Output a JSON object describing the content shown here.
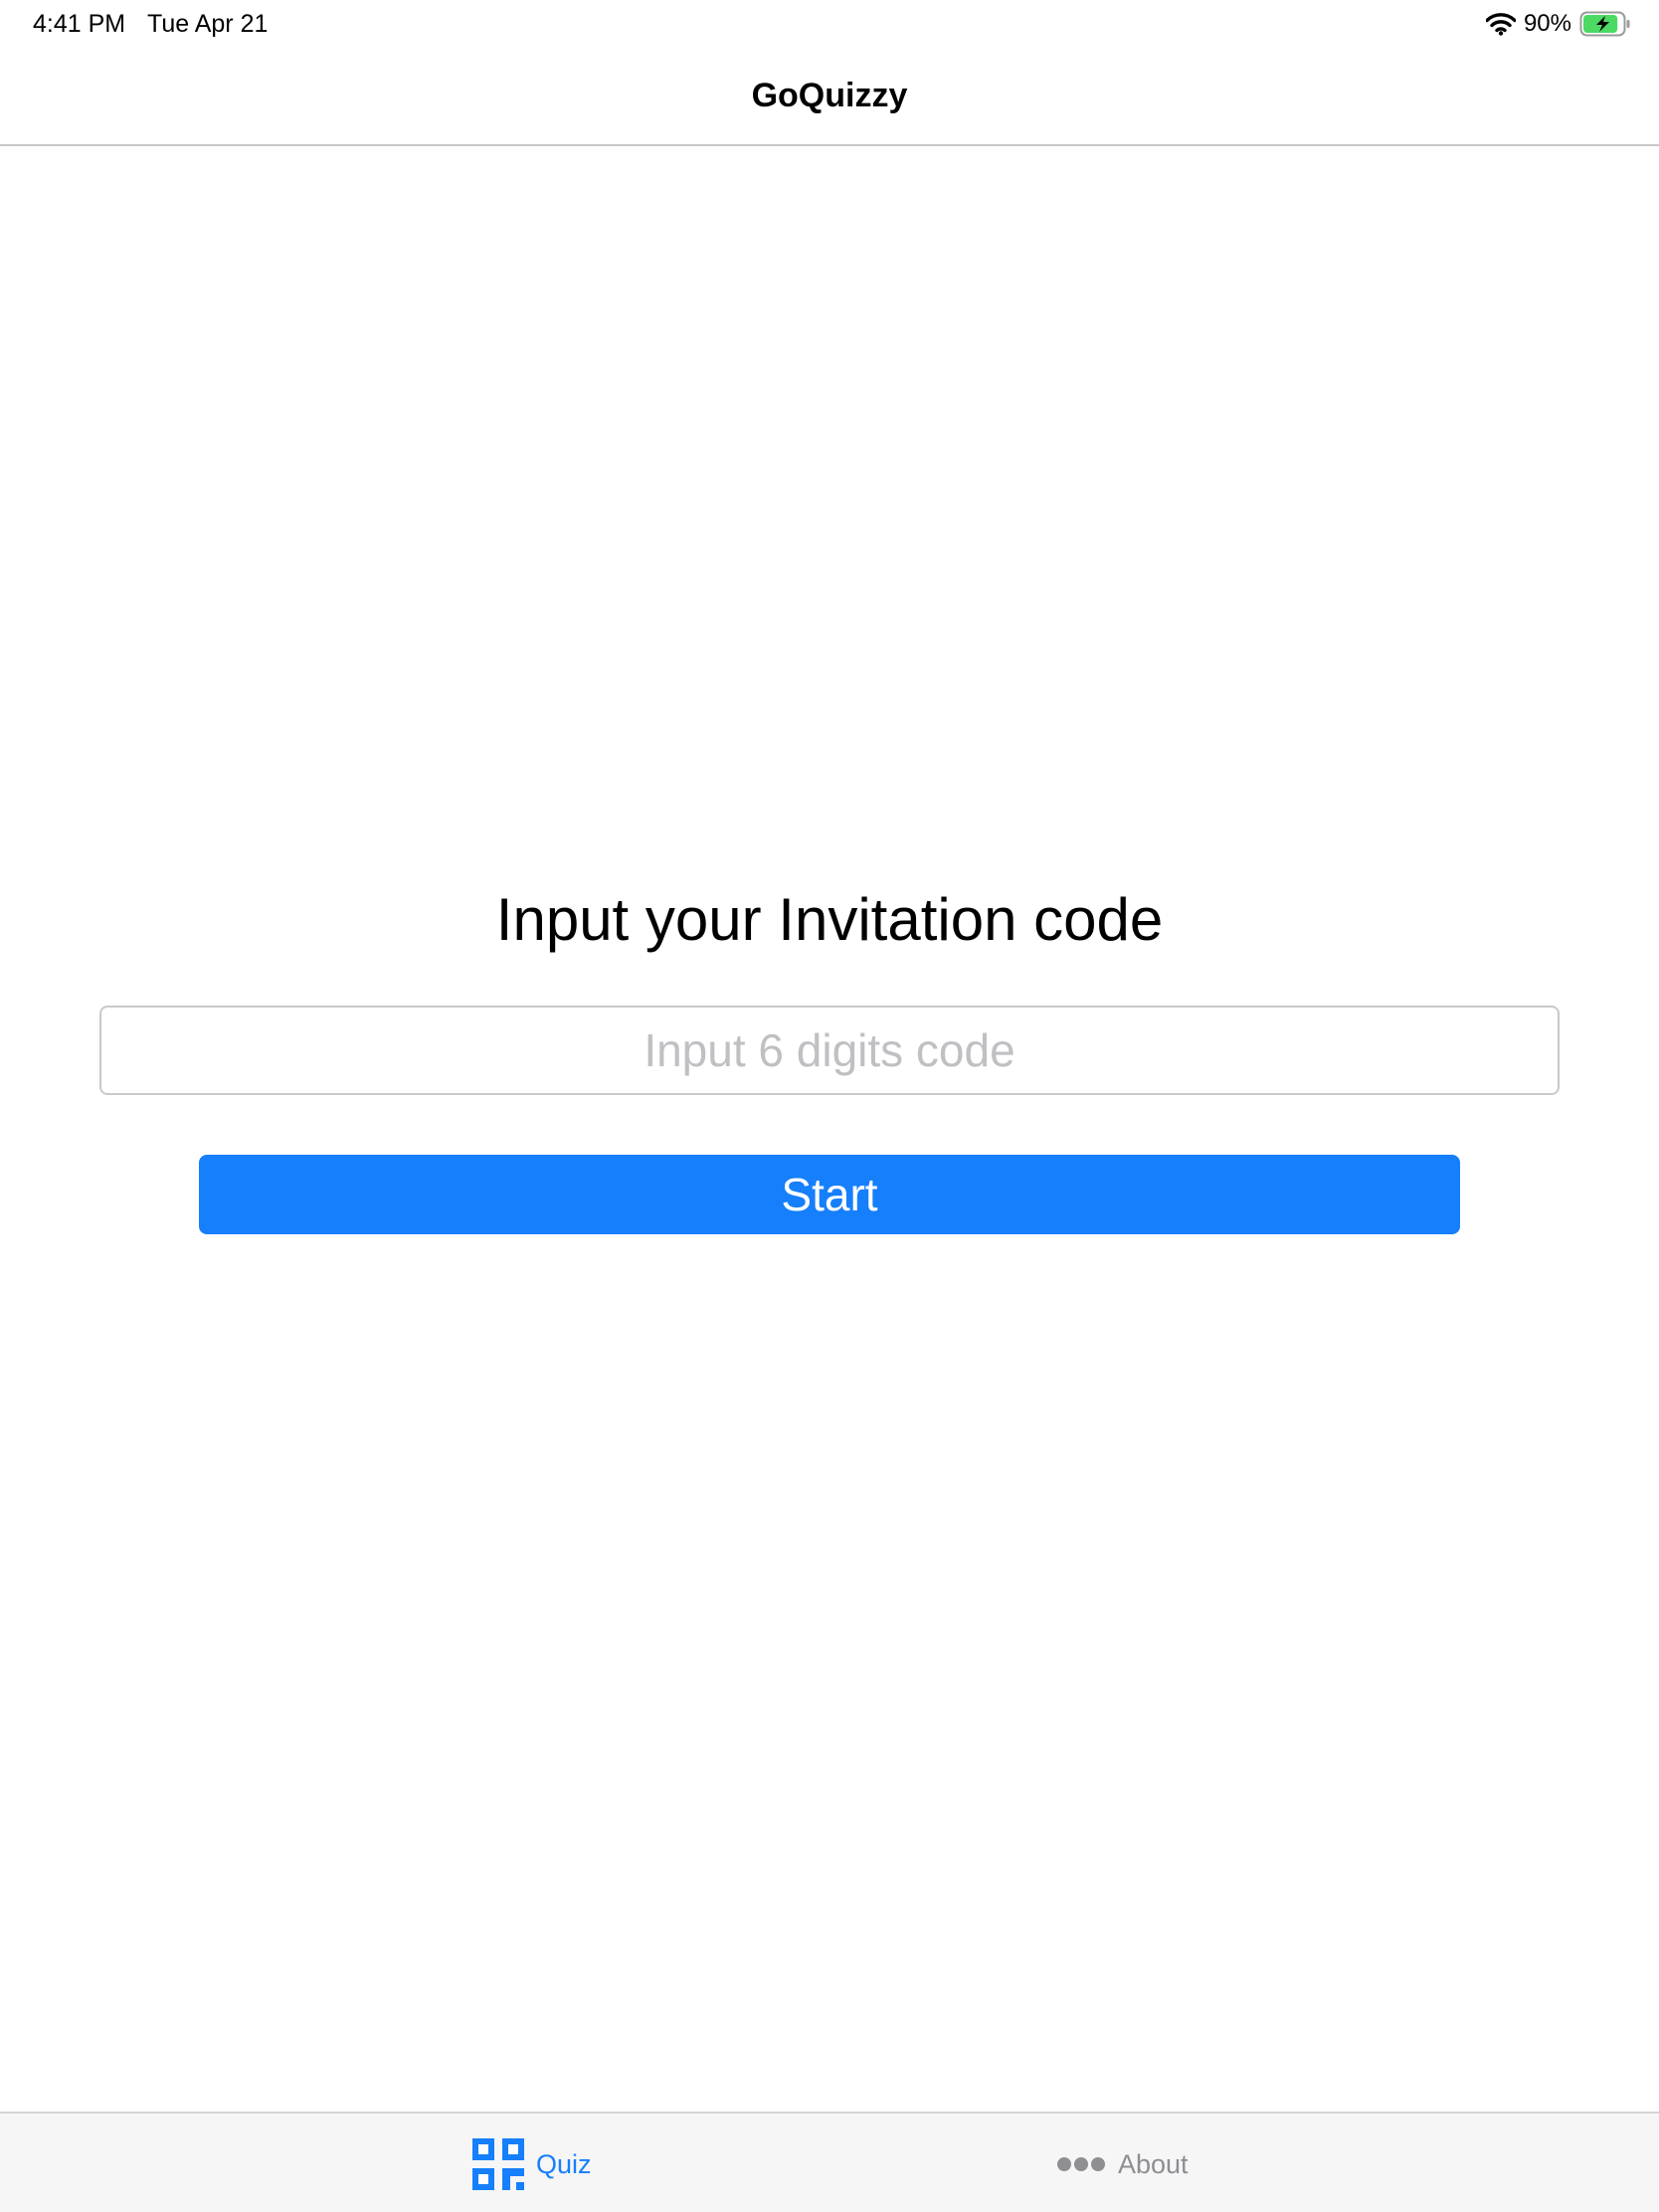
{
  "status_bar": {
    "time": "4:41 PM",
    "date": "Tue Apr 21",
    "battery_percent": "90%",
    "battery_level": 0.9,
    "wifi_icon": "wifi-icon",
    "battery_icon": "battery-charging-icon"
  },
  "nav": {
    "title": "GoQuizzy"
  },
  "main": {
    "heading": "Input your Invitation code",
    "code_input": {
      "value": "",
      "placeholder": "Input 6 digits code"
    },
    "start_label": "Start"
  },
  "tab_bar": {
    "tabs": [
      {
        "label": "Quiz",
        "icon": "qr-code-icon",
        "selected": true
      },
      {
        "label": "About",
        "icon": "more-dots-icon",
        "selected": false
      }
    ]
  },
  "colors": {
    "accent": "#167ffb",
    "inactive_tab": "#8e8e93",
    "battery_green": "#4cd964",
    "placeholder": "#c0c0c4"
  }
}
